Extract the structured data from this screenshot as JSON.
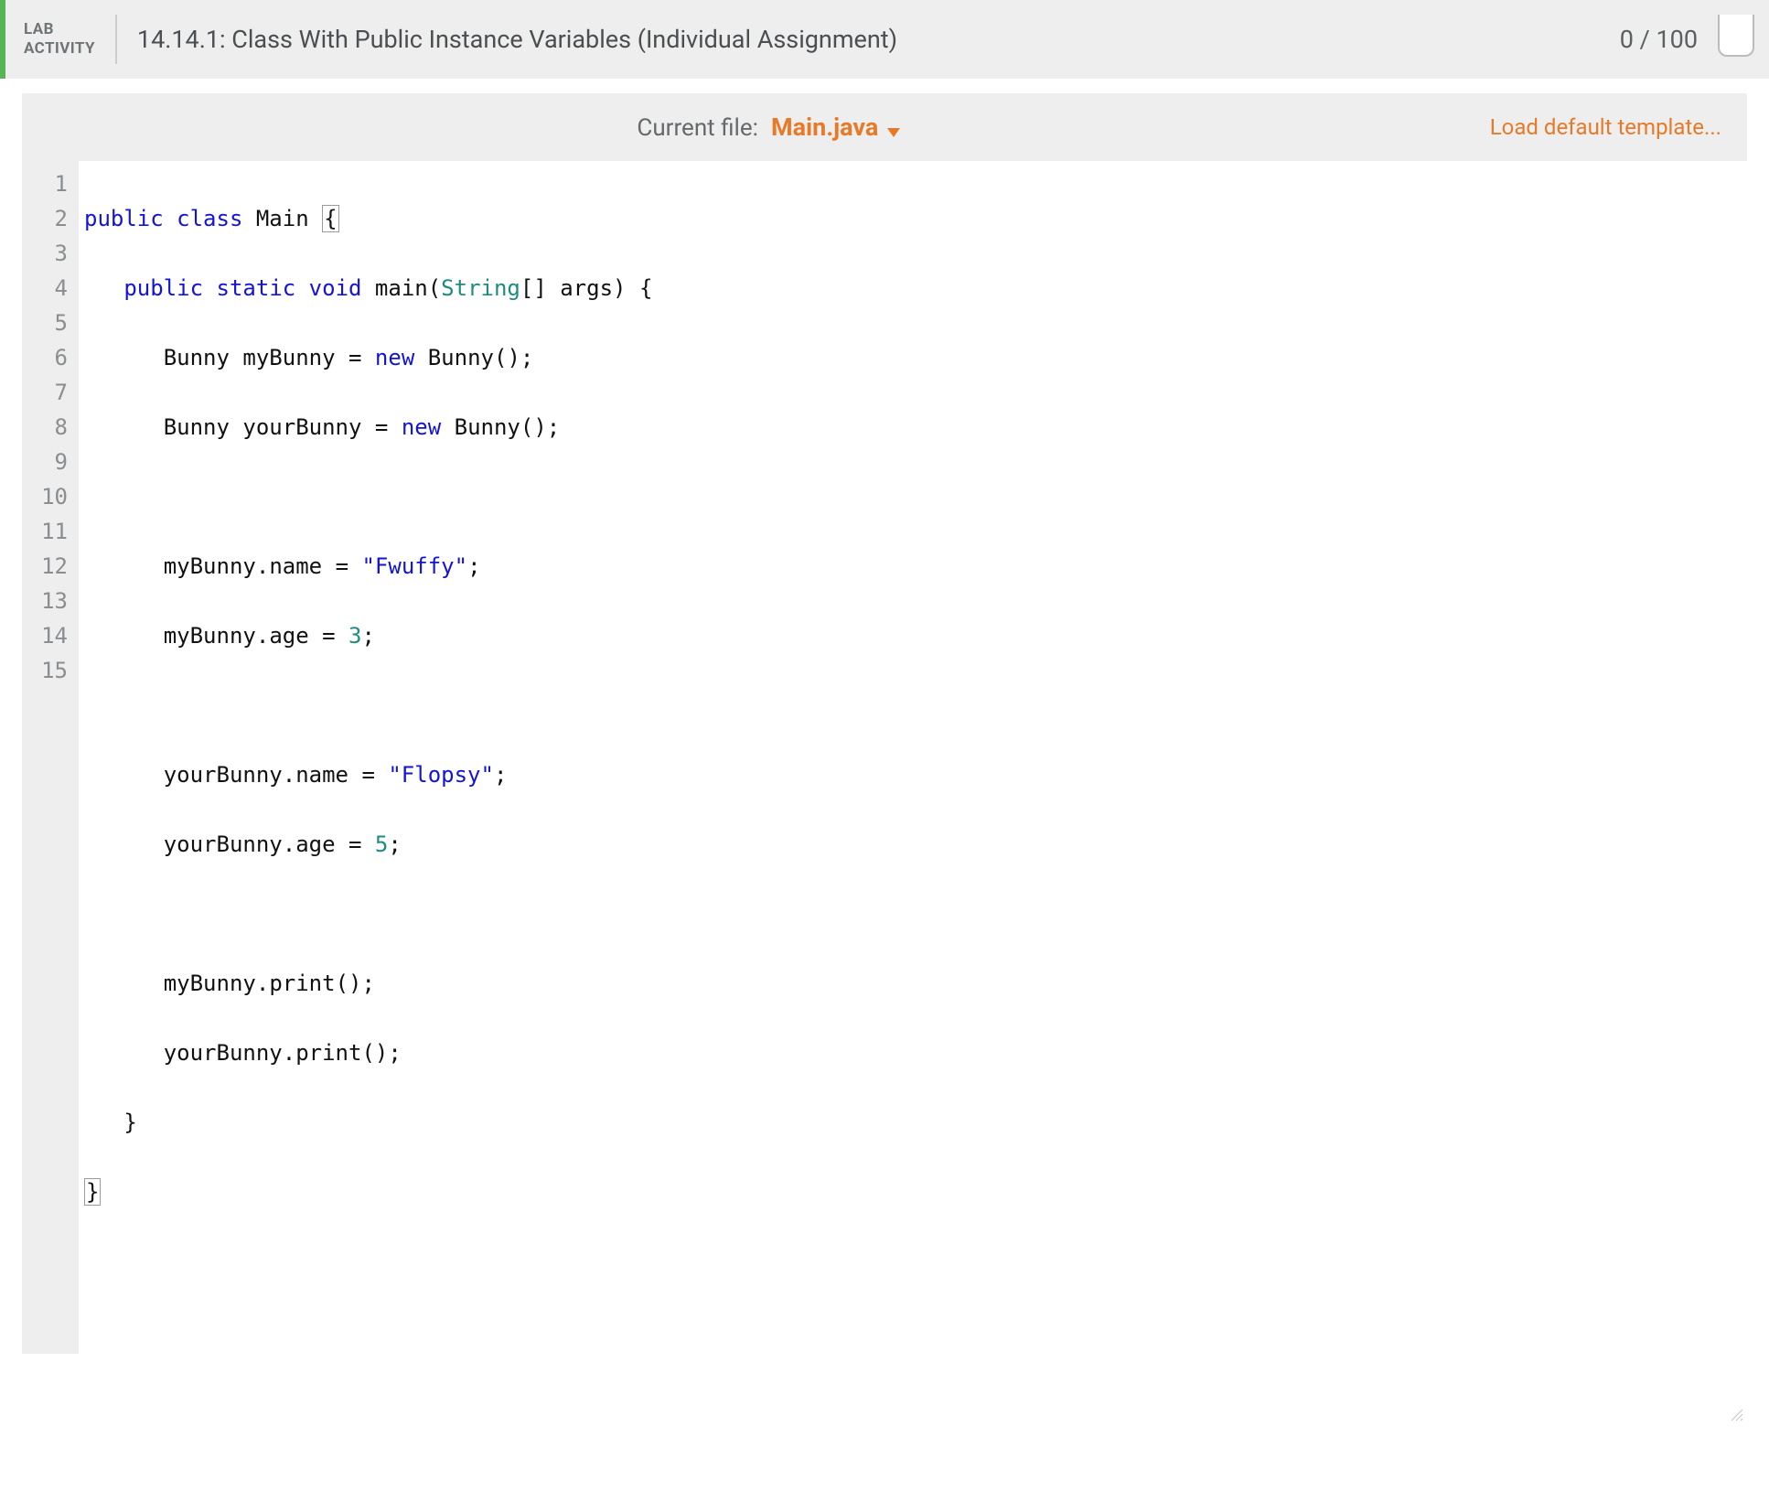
{
  "header": {
    "label_line1": "LAB",
    "label_line2": "ACTIVITY",
    "title": "14.14.1: Class With Public Instance Variables (Individual Assignment)",
    "score": "0 / 100"
  },
  "filebar": {
    "current_file_label": "Current file:",
    "file_name": "Main.java",
    "load_template": "Load default template..."
  },
  "code": {
    "lines": [
      {
        "n": 1
      },
      {
        "n": 2
      },
      {
        "n": 3
      },
      {
        "n": 4
      },
      {
        "n": 5
      },
      {
        "n": 6
      },
      {
        "n": 7
      },
      {
        "n": 8
      },
      {
        "n": 9
      },
      {
        "n": 10
      },
      {
        "n": 11
      },
      {
        "n": 12
      },
      {
        "n": 13
      },
      {
        "n": 14
      },
      {
        "n": 15
      }
    ],
    "tokens": {
      "kw_public": "public",
      "kw_class": "class",
      "kw_static": "static",
      "kw_void": "void",
      "kw_new": "new",
      "id_Main": "Main",
      "id_main": "main",
      "id_String": "String",
      "id_args": "args",
      "id_Bunny": "Bunny",
      "id_myBunny": "myBunny",
      "id_yourBunny": "yourBunny",
      "id_name": "name",
      "id_age": "age",
      "id_print": "print",
      "str_fwuffy": "\"Fwuffy\"",
      "str_flopsy": "\"Flopsy\"",
      "num_3": "3",
      "num_5": "5",
      "sym_lbrace": "{",
      "sym_rbrace": "}",
      "sym_lparen": "(",
      "sym_rparen": ")",
      "sym_lbracket": "[",
      "sym_rbracket": "]",
      "sym_semi": ";",
      "sym_eq": "=",
      "sym_dot": ".",
      "sp1": " ",
      "ind1": "   ",
      "ind2": "      "
    }
  }
}
